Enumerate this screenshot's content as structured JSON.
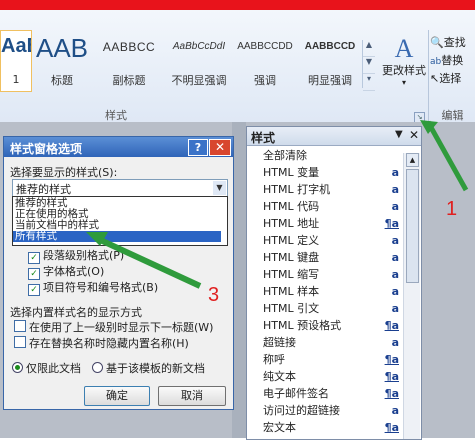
{
  "ribbon": {
    "style_tiles": [
      {
        "preview": "AaBbCc",
        "label": "1"
      },
      {
        "preview": "AAB",
        "label": "标题"
      },
      {
        "preview": "AABBCC",
        "label": "副标题"
      },
      {
        "preview": "AaBbCcDdI",
        "label": "不明显强调"
      },
      {
        "preview": "AABBCCDD",
        "label": "强调"
      },
      {
        "preview": "AABBCCD",
        "label": "明显强调"
      }
    ],
    "change_styles_label": "更改样式",
    "edit_items": [
      "查找",
      "替换",
      "选择"
    ],
    "group_styles_label": "样式",
    "group_edit_label": "编辑"
  },
  "styles_pane": {
    "title": "样式",
    "items": [
      {
        "name": "全部清除",
        "icon": ""
      },
      {
        "name": "HTML 变量",
        "icon": "a"
      },
      {
        "name": "HTML 打字机",
        "icon": "a"
      },
      {
        "name": "HTML 代码",
        "icon": "a"
      },
      {
        "name": "HTML 地址",
        "icon": "¶a"
      },
      {
        "name": "HTML 定义",
        "icon": "a"
      },
      {
        "name": "HTML 键盘",
        "icon": "a"
      },
      {
        "name": "HTML 缩写",
        "icon": "a"
      },
      {
        "name": "HTML 样本",
        "icon": "a"
      },
      {
        "name": "HTML 引文",
        "icon": "a"
      },
      {
        "name": "HTML 预设格式",
        "icon": "¶a"
      },
      {
        "name": "超链接",
        "icon": "a"
      },
      {
        "name": "称呼",
        "icon": "¶a"
      },
      {
        "name": "纯文本",
        "icon": "¶a"
      },
      {
        "name": "电子邮件签名",
        "icon": "¶a"
      },
      {
        "name": "访问过的超链接",
        "icon": "a"
      },
      {
        "name": "宏文本",
        "icon": "¶a"
      }
    ]
  },
  "dialog": {
    "title": "样式窗格选项",
    "help_label": "?",
    "close_label": "✕",
    "select_label": "选择要显示的样式(S):",
    "select_value": "推荐的样式",
    "options": [
      "推荐的样式",
      "正在使用的格式",
      "当前文档中的样式",
      "所有样式"
    ],
    "selected_option": "所有样式",
    "checkboxes": [
      {
        "label": "段落级别格式(P)",
        "checked": true
      },
      {
        "label": "字体格式(O)",
        "checked": true
      },
      {
        "label": "项目符号和编号格式(B)",
        "checked": true
      }
    ],
    "show_names_label": "选择内置样式名的显示方式",
    "name_options": [
      {
        "label": "在使用了上一级别时显示下一标题(W)",
        "checked": false
      },
      {
        "label": "存在替换名称时隐藏内置名称(H)",
        "checked": false
      }
    ],
    "scope": [
      {
        "label": "仅限此文档",
        "selected": true
      },
      {
        "label": "基于该模板的新文档",
        "selected": false
      }
    ],
    "ok_label": "确定",
    "cancel_label": "取消"
  },
  "annotations": {
    "n1": "1",
    "n3": "3",
    "color": "#e02020",
    "arrow_color": "#2f9b3c"
  }
}
